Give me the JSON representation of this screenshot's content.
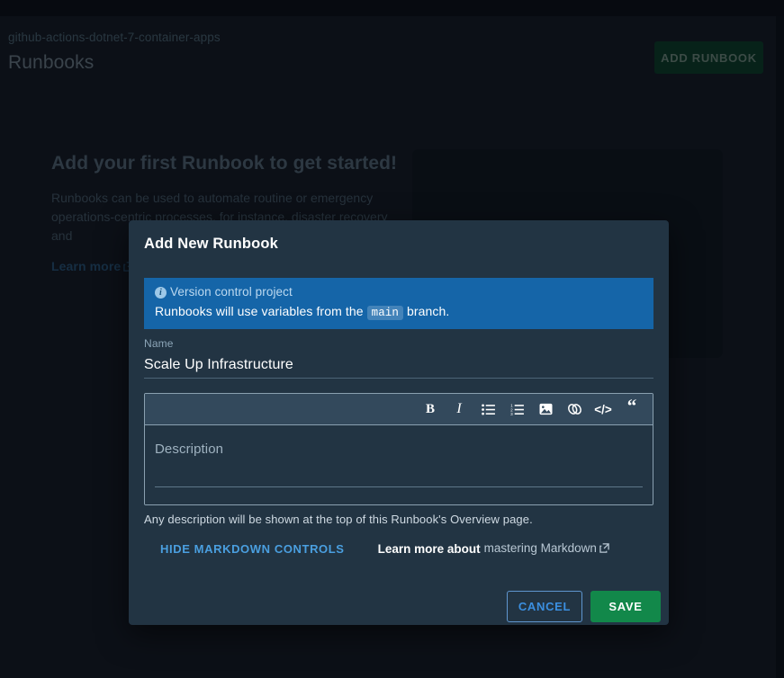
{
  "header": {
    "breadcrumb": "github-actions-dotnet-7-container-apps",
    "title": "Runbooks",
    "add_button_label": "ADD RUNBOOK"
  },
  "empty_state": {
    "heading": "Add your first Runbook to get started!",
    "body": "Runbooks can be used to automate routine or emergency operations-centric processes, for instance, disaster recovery and",
    "link_label": "Learn more",
    "link_external_icon": "external-link-icon"
  },
  "dialog": {
    "title": "Add New Runbook",
    "info_banner": {
      "icon": "info-circle-icon",
      "title": "Version control project",
      "body_prefix": "Runbooks will use variables from the",
      "branch": "main",
      "body_suffix": "branch."
    },
    "name_field": {
      "label": "Name",
      "value": "Scale Up Infrastructure",
      "placeholder": "Name"
    },
    "editor": {
      "placeholder": "Description",
      "toolbar": [
        {
          "name": "bold-icon",
          "glyph": "B"
        },
        {
          "name": "italic-icon",
          "glyph": "I"
        },
        {
          "name": "bullet-list-icon",
          "glyph": ""
        },
        {
          "name": "numbered-list-icon",
          "glyph": ""
        },
        {
          "name": "image-icon",
          "glyph": ""
        },
        {
          "name": "link-icon",
          "glyph": ""
        },
        {
          "name": "code-icon",
          "glyph": "</>"
        },
        {
          "name": "blockquote-icon",
          "glyph": "“"
        }
      ]
    },
    "helper_text": "Any description will be shown at the top of this Runbook's Overview page.",
    "hide_markdown_label": "HIDE MARKDOWN CONTROLS",
    "learn_more_prefix": "Learn more about",
    "learn_more_link": "mastering Markdown",
    "cancel_label": "CANCEL",
    "save_label": "SAVE"
  },
  "colors": {
    "page_background": "#141a22",
    "dialog_background": "#223443",
    "info_banner": "#1565a8",
    "save_green": "#12884a",
    "add_runbook_green": "#0a4127",
    "link_blue": "#4a9fe0"
  }
}
